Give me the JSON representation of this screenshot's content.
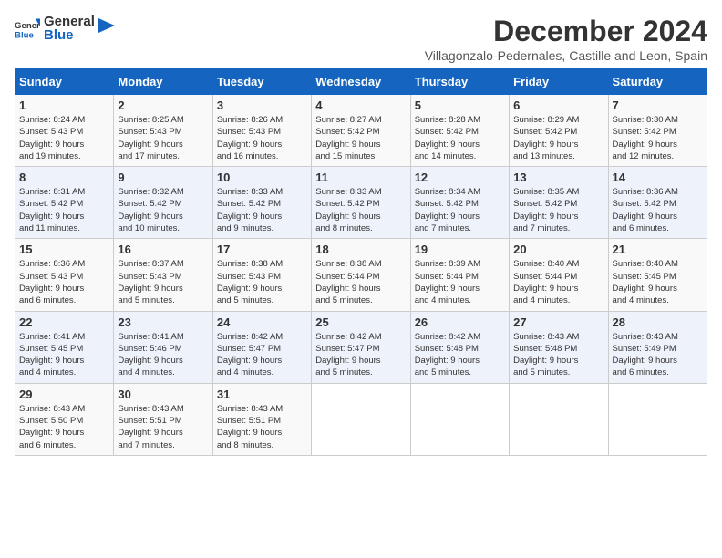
{
  "logo": {
    "general": "General",
    "blue": "Blue"
  },
  "title": "December 2024",
  "subtitle": "Villagonzalo-Pedernales, Castille and Leon, Spain",
  "weekdays": [
    "Sunday",
    "Monday",
    "Tuesday",
    "Wednesday",
    "Thursday",
    "Friday",
    "Saturday"
  ],
  "weeks": [
    [
      {
        "day": "1",
        "sunrise": "8:24 AM",
        "sunset": "5:43 PM",
        "daylight_hours": "9 hours and 19 minutes."
      },
      {
        "day": "2",
        "sunrise": "8:25 AM",
        "sunset": "5:43 PM",
        "daylight_hours": "9 hours and 17 minutes."
      },
      {
        "day": "3",
        "sunrise": "8:26 AM",
        "sunset": "5:43 PM",
        "daylight_hours": "9 hours and 16 minutes."
      },
      {
        "day": "4",
        "sunrise": "8:27 AM",
        "sunset": "5:42 PM",
        "daylight_hours": "9 hours and 15 minutes."
      },
      {
        "day": "5",
        "sunrise": "8:28 AM",
        "sunset": "5:42 PM",
        "daylight_hours": "9 hours and 14 minutes."
      },
      {
        "day": "6",
        "sunrise": "8:29 AM",
        "sunset": "5:42 PM",
        "daylight_hours": "9 hours and 13 minutes."
      },
      {
        "day": "7",
        "sunrise": "8:30 AM",
        "sunset": "5:42 PM",
        "daylight_hours": "9 hours and 12 minutes."
      }
    ],
    [
      {
        "day": "8",
        "sunrise": "8:31 AM",
        "sunset": "5:42 PM",
        "daylight_hours": "9 hours and 11 minutes."
      },
      {
        "day": "9",
        "sunrise": "8:32 AM",
        "sunset": "5:42 PM",
        "daylight_hours": "9 hours and 10 minutes."
      },
      {
        "day": "10",
        "sunrise": "8:33 AM",
        "sunset": "5:42 PM",
        "daylight_hours": "9 hours and 9 minutes."
      },
      {
        "day": "11",
        "sunrise": "8:33 AM",
        "sunset": "5:42 PM",
        "daylight_hours": "9 hours and 8 minutes."
      },
      {
        "day": "12",
        "sunrise": "8:34 AM",
        "sunset": "5:42 PM",
        "daylight_hours": "9 hours and 7 minutes."
      },
      {
        "day": "13",
        "sunrise": "8:35 AM",
        "sunset": "5:42 PM",
        "daylight_hours": "9 hours and 7 minutes."
      },
      {
        "day": "14",
        "sunrise": "8:36 AM",
        "sunset": "5:42 PM",
        "daylight_hours": "9 hours and 6 minutes."
      }
    ],
    [
      {
        "day": "15",
        "sunrise": "8:36 AM",
        "sunset": "5:43 PM",
        "daylight_hours": "9 hours and 6 minutes."
      },
      {
        "day": "16",
        "sunrise": "8:37 AM",
        "sunset": "5:43 PM",
        "daylight_hours": "9 hours and 5 minutes."
      },
      {
        "day": "17",
        "sunrise": "8:38 AM",
        "sunset": "5:43 PM",
        "daylight_hours": "9 hours and 5 minutes."
      },
      {
        "day": "18",
        "sunrise": "8:38 AM",
        "sunset": "5:44 PM",
        "daylight_hours": "9 hours and 5 minutes."
      },
      {
        "day": "19",
        "sunrise": "8:39 AM",
        "sunset": "5:44 PM",
        "daylight_hours": "9 hours and 4 minutes."
      },
      {
        "day": "20",
        "sunrise": "8:40 AM",
        "sunset": "5:44 PM",
        "daylight_hours": "9 hours and 4 minutes."
      },
      {
        "day": "21",
        "sunrise": "8:40 AM",
        "sunset": "5:45 PM",
        "daylight_hours": "9 hours and 4 minutes."
      }
    ],
    [
      {
        "day": "22",
        "sunrise": "8:41 AM",
        "sunset": "5:45 PM",
        "daylight_hours": "9 hours and 4 minutes."
      },
      {
        "day": "23",
        "sunrise": "8:41 AM",
        "sunset": "5:46 PM",
        "daylight_hours": "9 hours and 4 minutes."
      },
      {
        "day": "24",
        "sunrise": "8:42 AM",
        "sunset": "5:47 PM",
        "daylight_hours": "9 hours and 4 minutes."
      },
      {
        "day": "25",
        "sunrise": "8:42 AM",
        "sunset": "5:47 PM",
        "daylight_hours": "9 hours and 5 minutes."
      },
      {
        "day": "26",
        "sunrise": "8:42 AM",
        "sunset": "5:48 PM",
        "daylight_hours": "9 hours and 5 minutes."
      },
      {
        "day": "27",
        "sunrise": "8:43 AM",
        "sunset": "5:48 PM",
        "daylight_hours": "9 hours and 5 minutes."
      },
      {
        "day": "28",
        "sunrise": "8:43 AM",
        "sunset": "5:49 PM",
        "daylight_hours": "9 hours and 6 minutes."
      }
    ],
    [
      {
        "day": "29",
        "sunrise": "8:43 AM",
        "sunset": "5:50 PM",
        "daylight_hours": "9 hours and 6 minutes."
      },
      {
        "day": "30",
        "sunrise": "8:43 AM",
        "sunset": "5:51 PM",
        "daylight_hours": "9 hours and 7 minutes."
      },
      {
        "day": "31",
        "sunrise": "8:43 AM",
        "sunset": "5:51 PM",
        "daylight_hours": "9 hours and 8 minutes."
      },
      null,
      null,
      null,
      null
    ]
  ],
  "labels": {
    "sunrise": "Sunrise:",
    "sunset": "Sunset:",
    "daylight": "Daylight:"
  }
}
